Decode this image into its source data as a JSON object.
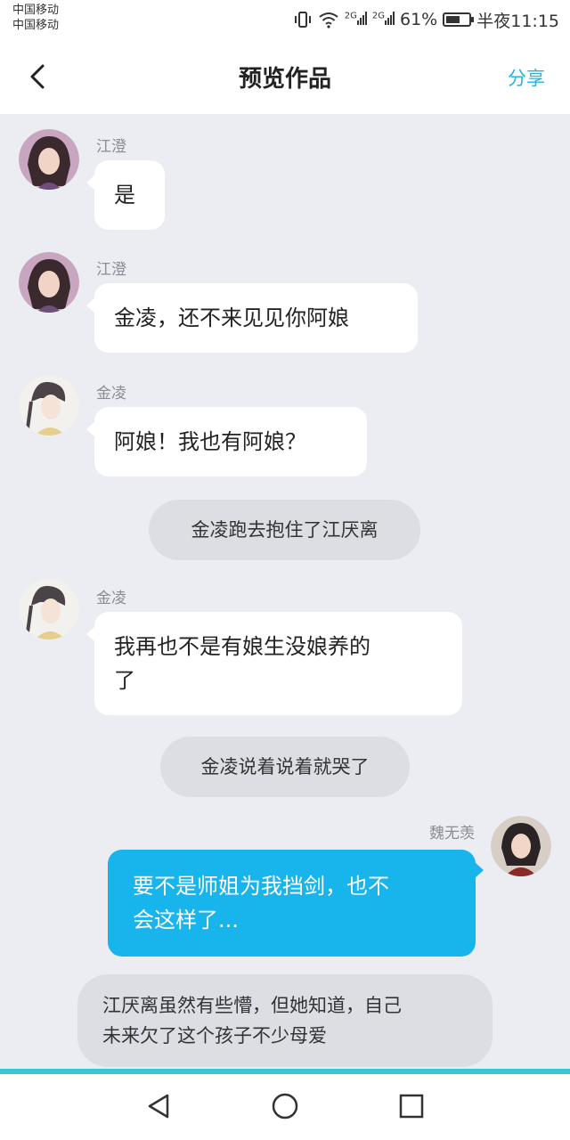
{
  "status_bar": {
    "carrier_1": "中国移动",
    "carrier_2": "中国移动",
    "net_1": "2G",
    "net_2": "2G",
    "battery": "61%",
    "battery_level": 0.61,
    "time": "半夜11:15",
    "icons": [
      "vibrate-icon",
      "wifi-icon",
      "signal-icon",
      "battery-icon"
    ]
  },
  "header": {
    "title": "预览作品",
    "share_label": "分享",
    "accent_color": "#2ab3d9"
  },
  "messages": [
    {
      "type": "received",
      "sender": "江澄",
      "text": "是"
    },
    {
      "type": "received",
      "sender": "江澄",
      "text": "金凌，还不来见见你阿娘"
    },
    {
      "type": "received",
      "sender": "金凌",
      "text": "阿娘！我也有阿娘？"
    },
    {
      "type": "narration",
      "text": "金凌跑去抱住了江厌离"
    },
    {
      "type": "received",
      "sender": "金凌",
      "line_1": "我再也不是有娘生没娘养的",
      "line_2": "了"
    },
    {
      "type": "narration",
      "text": "金凌说着说着就哭了"
    },
    {
      "type": "sent",
      "sender": "魏无羡",
      "line_1": "要不是师姐为我挡剑，也不",
      "line_2": "会这样了..."
    },
    {
      "type": "narration",
      "line_1": "江厌离虽然有些懵，但她知道，自己",
      "line_2": "未来欠了这个孩子不少母爱"
    }
  ],
  "colors": {
    "sent_bubble": "#18b4ec",
    "background": "#ebedf2"
  },
  "nav": {
    "icons": [
      "back-triangle-icon",
      "home-circle-icon",
      "recents-square-icon"
    ]
  }
}
